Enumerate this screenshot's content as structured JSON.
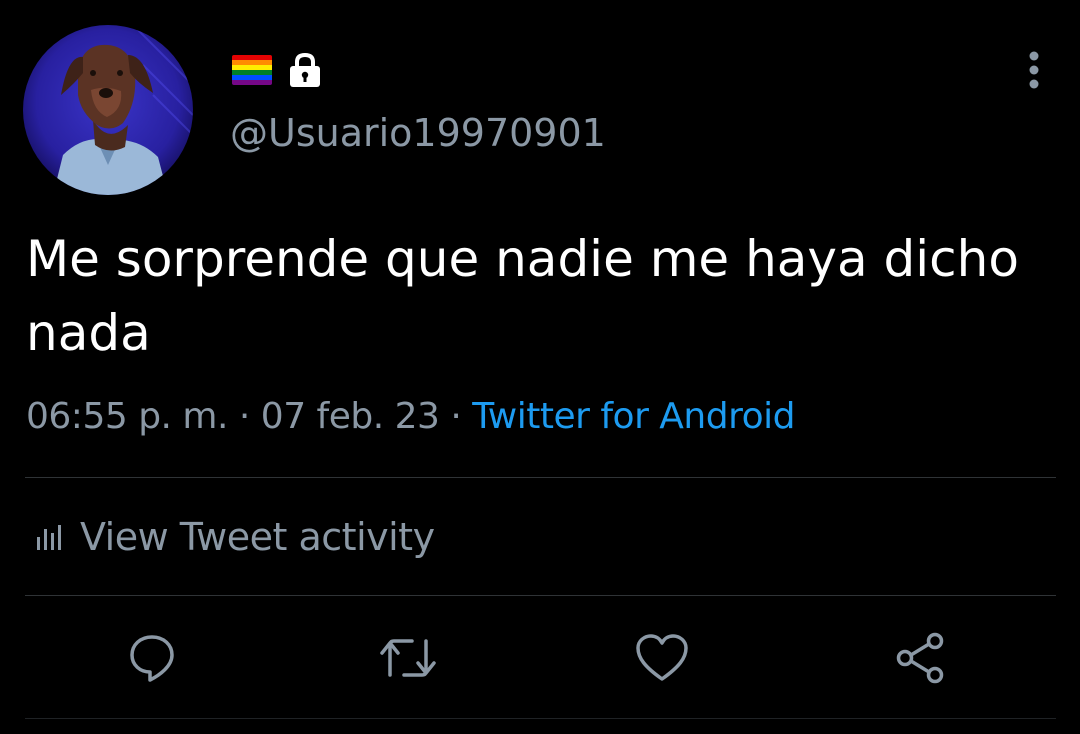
{
  "tweet": {
    "handle": "@Usuario19970901",
    "text": "Me sorprende que nadie me haya dicho nada",
    "time": "06:55 p. m.",
    "separator": " · ",
    "date": "07 feb. 23",
    "source": "Twitter for Android",
    "activity_label": "View Tweet activity"
  },
  "badges": {
    "flag_icon": "rainbow-flag-icon",
    "flag_colors": [
      "#e40303",
      "#ff8c00",
      "#ffed00",
      "#008026",
      "#004dff",
      "#750787"
    ],
    "lock_icon": "lock-icon"
  },
  "actions": [
    {
      "icon": "reply-icon"
    },
    {
      "icon": "retweet-icon"
    },
    {
      "icon": "like-icon"
    },
    {
      "icon": "share-icon"
    }
  ],
  "colors": {
    "background": "#000000",
    "text_primary": "#ffffff",
    "text_secondary": "#8b98a5",
    "link": "#1d9bf0",
    "divider": "#2f3336"
  }
}
